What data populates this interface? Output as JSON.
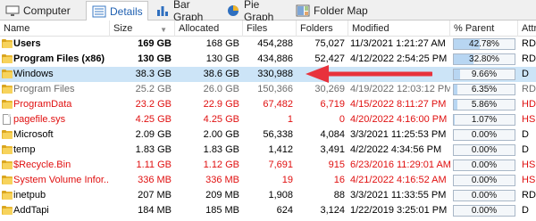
{
  "tabs": [
    {
      "label": "Computer",
      "icon": "computer-icon"
    },
    {
      "label": "Details",
      "icon": "details-list-icon"
    },
    {
      "label": "Bar Graph",
      "icon": "bar-graph-icon"
    },
    {
      "label": "Pie Graph",
      "icon": "pie-graph-icon"
    },
    {
      "label": "Folder Map",
      "icon": "folder-map-icon"
    }
  ],
  "active_tab": "Details",
  "columns": {
    "name": "Name",
    "size": "Size",
    "allocated": "Allocated",
    "files": "Files",
    "folders": "Folders",
    "modified": "Modified",
    "parent": "% Parent",
    "attributes": "Attr"
  },
  "rows": [
    {
      "name": "Users",
      "size": "169 GB",
      "allocated": "168 GB",
      "files": "454,288",
      "folders": "75,027",
      "modified": "11/3/2021 1:21:27 AM",
      "parent": "42.78%",
      "parent_value": 42.78,
      "attr": "RD",
      "style": "bold",
      "icon": "folder-icon"
    },
    {
      "name": "Program Files (x86)",
      "size": "130 GB",
      "allocated": "130 GB",
      "files": "434,886",
      "folders": "52,427",
      "modified": "4/12/2022 2:54:25 PM",
      "parent": "32.80%",
      "parent_value": 32.8,
      "attr": "RD",
      "style": "bold",
      "icon": "folder-icon"
    },
    {
      "name": "Windows",
      "size": "38.3 GB",
      "allocated": "38.6 GB",
      "files": "330,988",
      "folders": "",
      "modified": "",
      "parent": "9.66%",
      "parent_value": 9.66,
      "attr": "D",
      "style": "selected",
      "icon": "folder-icon"
    },
    {
      "name": "Program Files",
      "size": "25.2 GB",
      "allocated": "26.0 GB",
      "files": "150,366",
      "folders": "30,269",
      "modified": "4/19/2022 12:03:12 PM",
      "parent": "6.35%",
      "parent_value": 6.35,
      "attr": "RD",
      "style": "gray",
      "icon": "folder-icon"
    },
    {
      "name": "ProgramData",
      "size": "23.2 GB",
      "allocated": "22.9 GB",
      "files": "67,482",
      "folders": "6,719",
      "modified": "4/15/2022 8:11:27 PM",
      "parent": "5.86%",
      "parent_value": 5.86,
      "attr": "HD",
      "style": "red",
      "icon": "folder-icon"
    },
    {
      "name": "pagefile.sys",
      "size": "4.25 GB",
      "allocated": "4.25 GB",
      "files": "1",
      "folders": "0",
      "modified": "4/20/2022 4:16:00 PM",
      "parent": "1.07%",
      "parent_value": 1.07,
      "attr": "HS",
      "style": "red",
      "icon": "file-icon"
    },
    {
      "name": "Microsoft",
      "size": "2.09 GB",
      "allocated": "2.00 GB",
      "files": "56,338",
      "folders": "4,084",
      "modified": "3/3/2021 11:25:53 PM",
      "parent": "0.00%",
      "parent_value": 0,
      "attr": "D",
      "style": "normal",
      "icon": "folder-icon"
    },
    {
      "name": "temp",
      "size": "1.83 GB",
      "allocated": "1.83 GB",
      "files": "1,412",
      "folders": "3,491",
      "modified": "4/2/2022 4:34:56 PM",
      "parent": "0.00%",
      "parent_value": 0,
      "attr": "D",
      "style": "normal",
      "icon": "folder-icon"
    },
    {
      "name": "$Recycle.Bin",
      "size": "1.11 GB",
      "allocated": "1.12 GB",
      "files": "7,691",
      "folders": "915",
      "modified": "6/23/2016 11:29:01 AM",
      "parent": "0.00%",
      "parent_value": 0,
      "attr": "HS",
      "style": "red",
      "icon": "folder-icon"
    },
    {
      "name": "System Volume Infor...",
      "size": "336 MB",
      "allocated": "336 MB",
      "files": "19",
      "folders": "16",
      "modified": "4/21/2022 4:16:52 AM",
      "parent": "0.00%",
      "parent_value": 0,
      "attr": "HS",
      "style": "red",
      "icon": "folder-icon"
    },
    {
      "name": "inetpub",
      "size": "207 MB",
      "allocated": "209 MB",
      "files": "1,908",
      "folders": "88",
      "modified": "3/3/2021 11:33:55 PM",
      "parent": "0.00%",
      "parent_value": 0,
      "attr": "RD",
      "style": "normal",
      "icon": "folder-icon"
    },
    {
      "name": "AddTapi",
      "size": "184 MB",
      "allocated": "185 MB",
      "files": "624",
      "folders": "3,124",
      "modified": "1/22/2019 3:25:01 PM",
      "parent": "0.00%",
      "parent_value": 0,
      "attr": "D",
      "style": "normal",
      "icon": "folder-icon"
    }
  ],
  "colors": {
    "accent": "#1e5fb0",
    "selected_row": "#cce4f7",
    "red_text": "#e01010",
    "gray_text": "#6d6d6d",
    "bar_fill": "#b8d6f2",
    "arrow": "#e8323c"
  },
  "annotation": {
    "icon": "red-arrow-icon"
  }
}
